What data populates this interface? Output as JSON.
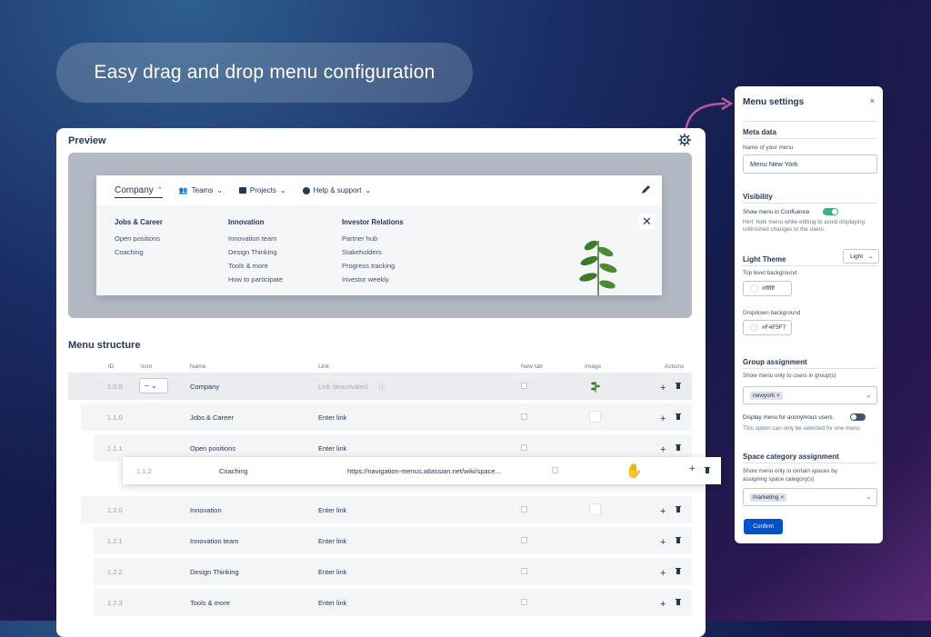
{
  "headline": "Easy drag and drop menu configuration",
  "preview": {
    "title": "Preview",
    "menubar": [
      {
        "label": "Company",
        "icon": "caret-up-icon"
      },
      {
        "label": "Teams",
        "icon": "people-icon"
      },
      {
        "label": "Projects",
        "icon": "folder-icon"
      },
      {
        "label": "Help & support",
        "icon": "chat-icon"
      }
    ],
    "columns": [
      {
        "heading": "Jobs & Career",
        "links": [
          "Open positions",
          "Coaching"
        ]
      },
      {
        "heading": "Innovation",
        "links": [
          "Innovation team",
          "Design Thinking",
          "Tools & more",
          "How to participate"
        ]
      },
      {
        "heading": "Investor Relations",
        "links": [
          "Partner hub",
          "Stakeholders",
          "Progress tracking",
          "Investor weekly"
        ]
      }
    ]
  },
  "structure": {
    "title": "Menu structure",
    "headers": {
      "id": "ID",
      "icon": "Icon",
      "name": "Name",
      "link": "Link",
      "newtab": "New tab",
      "image": "Image",
      "actions": "Actions"
    },
    "rows": [
      {
        "id": "1.0.0",
        "name": "Company",
        "link": "Link deactivated",
        "icon": "−",
        "image": "plant"
      },
      {
        "id": "1.1.0",
        "name": "Jobs & Career",
        "link": "Enter link",
        "image": "placeholder"
      },
      {
        "id": "1.1.1",
        "name": "Open positions",
        "link": "Enter link"
      },
      {
        "id": "1.2.0",
        "name": "Innovation",
        "link": "Enter link",
        "image": "placeholder"
      },
      {
        "id": "1.2.1",
        "name": "Innovation team",
        "link": "Enter link"
      },
      {
        "id": "1.2.2",
        "name": "Design Thinking",
        "link": "Enter link"
      },
      {
        "id": "1.2.3",
        "name": "Tools & more",
        "link": "Enter link"
      }
    ],
    "dragging": {
      "id": "1.1.2",
      "name": "Coaching",
      "link": "https://navigation-menus.atlassian.net/wiki/space..."
    }
  },
  "settings": {
    "title": "Menu settings",
    "close": "×",
    "meta_heading": "Meta data",
    "name_label": "Name of your menu",
    "name_value": "Menu New York",
    "visibility_heading": "Visibility",
    "show_label": "Show menu in Confluence",
    "hint": "Hint: hide menu while editing to avoid displaying unfinished changes to the users.",
    "theme_heading": "Light Theme",
    "theme_value": "Light",
    "top_bg_label": "Top level background",
    "top_bg_value": "#ffffff",
    "dd_bg_label": "Dropdown background",
    "dd_bg_value": "#F4F5F7",
    "group_heading": "Group assignment",
    "group_label": "Show menu only to users in group(s)",
    "group_chip": "newyork",
    "anon_label": "Display menu for anonymous users",
    "anon_hint": "This option can only be selected for one menu",
    "space_heading": "Space category assignment",
    "space_label": "Show menu only in certain spaces by assigning space category(s)",
    "space_chip": "marketing",
    "confirm": "Confirm"
  },
  "colors": {
    "accent": "#0052cc",
    "toggle_on": "#36b37e",
    "arrow": "#c0569f"
  }
}
